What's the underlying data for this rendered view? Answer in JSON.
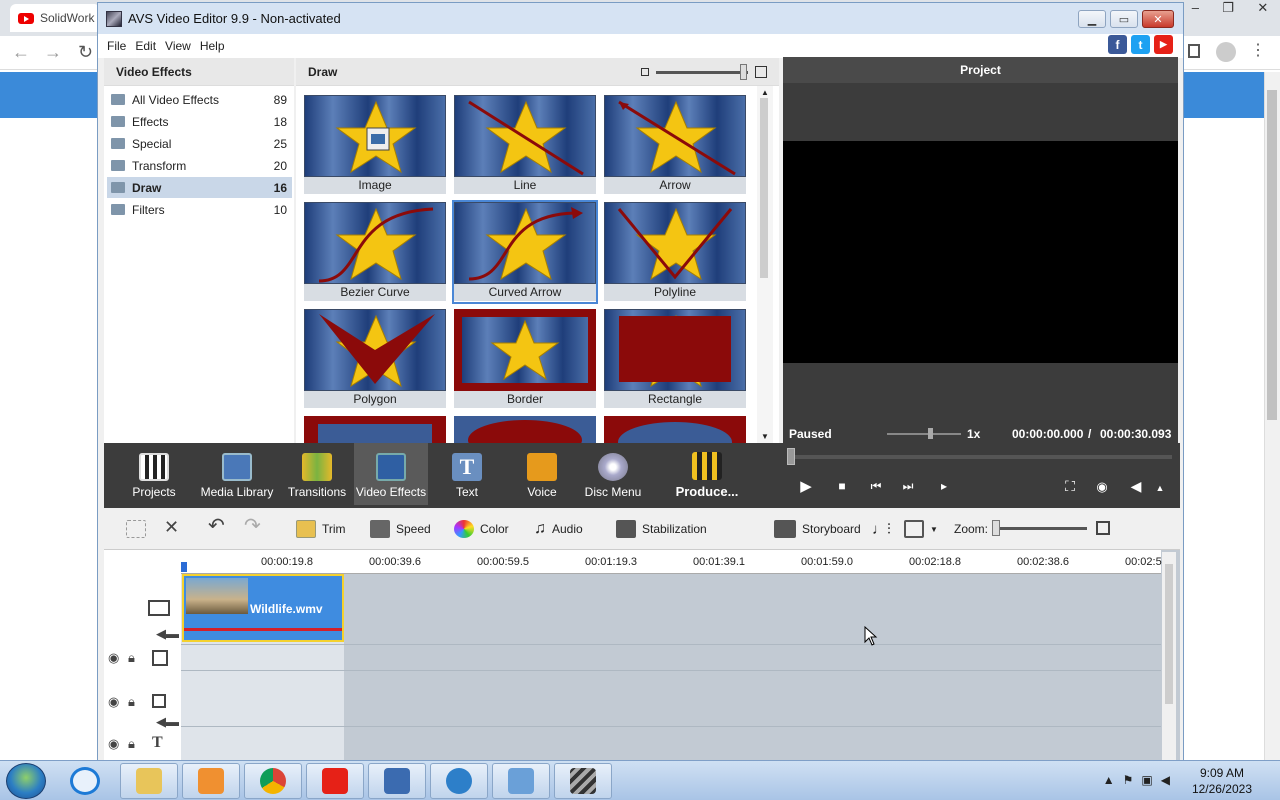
{
  "browser": {
    "tab_title": "SolidWork",
    "nav": {
      "back": "←",
      "forward": "→",
      "reload": "↻"
    },
    "window_controls": [
      "–",
      "❐",
      "✕"
    ]
  },
  "window": {
    "title": "AVS Video Editor 9.9 - Non-activated",
    "menu": [
      "File",
      "Edit",
      "View",
      "Help"
    ],
    "social": {
      "facebook": "f",
      "twitter": "t",
      "youtube": "▶"
    },
    "colors": {
      "facebook": "#3b5998",
      "twitter": "#1da1f2",
      "youtube": "#e62117"
    }
  },
  "effects_panel": {
    "title": "Video Effects",
    "folders": [
      {
        "name": "All Video Effects",
        "count": "89"
      },
      {
        "name": "Effects",
        "count": "18"
      },
      {
        "name": "Special",
        "count": "25"
      },
      {
        "name": "Transform",
        "count": "20"
      },
      {
        "name": "Draw",
        "count": "16",
        "selected": true
      },
      {
        "name": "Filters",
        "count": "10"
      }
    ]
  },
  "draw_panel": {
    "title": "Draw",
    "tiles": [
      "Image",
      "Line",
      "Arrow",
      "Bezier Curve",
      "Curved Arrow",
      "Polyline",
      "Polygon",
      "Border",
      "Rectangle"
    ],
    "selected_tile": "Curved Arrow"
  },
  "preview": {
    "title": "Project",
    "status": "Paused",
    "speed": "1x",
    "time_current": "00:00:00.000",
    "time_sep": "/",
    "time_total": "00:00:30.093"
  },
  "mainbar": {
    "buttons": [
      "Projects",
      "Media Library",
      "Transitions",
      "Video Effects",
      "Text",
      "Voice",
      "Disc Menu",
      "Produce..."
    ],
    "active": "Video Effects"
  },
  "tools": {
    "trim": "Trim",
    "speed": "Speed",
    "color": "Color",
    "audio": "Audio",
    "stabilization": "Stabilization",
    "storyboard": "Storyboard",
    "zoom": "Zoom:"
  },
  "timeline": {
    "ticks": [
      "00:00:19.8",
      "00:00:39.6",
      "00:00:59.5",
      "00:01:19.3",
      "00:01:39.1",
      "00:01:59.0",
      "00:02:18.8",
      "00:02:38.6",
      "00:02:5"
    ],
    "clip_name": "Wildlife.wmv"
  },
  "taskbar": {
    "time": "9:09 AM",
    "date": "12/26/2023"
  }
}
